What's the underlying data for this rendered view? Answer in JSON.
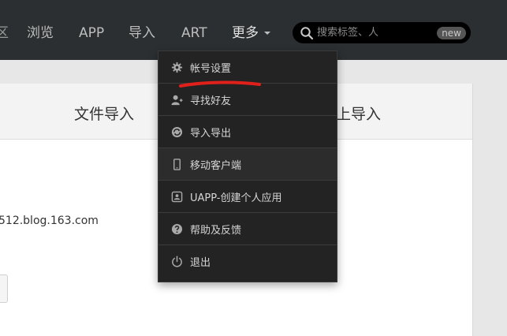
{
  "nav": {
    "edge_fragment": "区",
    "items": [
      {
        "label": "浏览"
      },
      {
        "label": "APP"
      },
      {
        "label": "导入"
      },
      {
        "label": "ART"
      },
      {
        "label": "更多"
      }
    ]
  },
  "search": {
    "placeholder": "搜索标签、人",
    "badge": "new"
  },
  "tabs": {
    "file_import": "文件导入",
    "online_import_fragment": "上导入"
  },
  "content": {
    "blog_url_fragment": "512.blog.163.com"
  },
  "dropdown": {
    "items": [
      {
        "label": "帐号设置",
        "icon": "gear-icon"
      },
      {
        "label": "寻找好友",
        "icon": "add-user-icon"
      },
      {
        "label": "导入导出",
        "icon": "sync-icon"
      },
      {
        "label": "移动客户端",
        "icon": "mobile-icon"
      },
      {
        "label": "UAPP-创建个人应用",
        "icon": "app-icon"
      },
      {
        "label": "帮助及反馈",
        "icon": "help-icon"
      },
      {
        "label": "退出",
        "icon": "power-icon"
      }
    ]
  },
  "colors": {
    "topbar": "#2b2f31",
    "dropdown": "#232323",
    "annotation": "#e0201b"
  }
}
